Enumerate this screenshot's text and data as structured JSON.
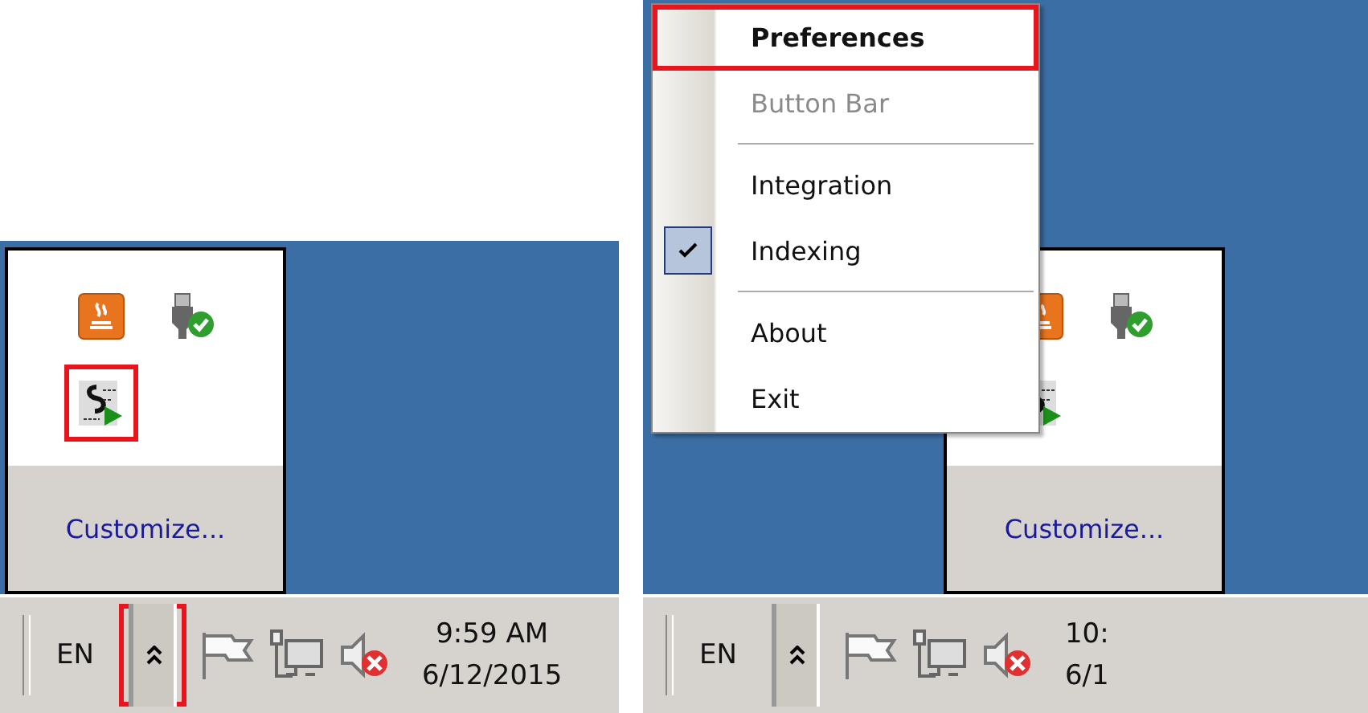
{
  "left_screen": {
    "tray_overflow": {
      "icons": [
        {
          "kind": "java",
          "highlighted": false
        },
        {
          "kind": "usb",
          "highlighted": false
        },
        {
          "kind": "script",
          "highlighted": true
        }
      ],
      "customize_link": "Customize..."
    },
    "taskbar": {
      "language": "EN",
      "overflow_button": {
        "highlighted": true
      },
      "time": "9:59 AM",
      "date": "6/12/2015"
    }
  },
  "right_screen": {
    "context_menu": {
      "items": [
        {
          "kind": "item",
          "label": "Preferences",
          "bold": true,
          "disabled": false,
          "checked": false,
          "highlighted": true
        },
        {
          "kind": "item",
          "label": "Button Bar",
          "bold": false,
          "disabled": true,
          "checked": false,
          "highlighted": false
        },
        {
          "kind": "separator"
        },
        {
          "kind": "item",
          "label": "Integration",
          "bold": false,
          "disabled": false,
          "checked": false,
          "highlighted": false
        },
        {
          "kind": "item",
          "label": "Indexing",
          "bold": false,
          "disabled": false,
          "checked": true,
          "highlighted": false
        },
        {
          "kind": "separator"
        },
        {
          "kind": "item",
          "label": "About",
          "bold": false,
          "disabled": false,
          "checked": false,
          "highlighted": false
        },
        {
          "kind": "item",
          "label": "Exit",
          "bold": false,
          "disabled": false,
          "checked": false,
          "highlighted": false
        }
      ]
    },
    "tray_overflow": {
      "icons": [
        {
          "kind": "java",
          "highlighted": false
        },
        {
          "kind": "usb",
          "highlighted": false
        },
        {
          "kind": "script",
          "highlighted": false
        }
      ],
      "customize_link": "Customize..."
    },
    "taskbar": {
      "language": "EN",
      "overflow_button": {
        "highlighted": false
      },
      "time": "10:",
      "date": "6/1"
    }
  }
}
